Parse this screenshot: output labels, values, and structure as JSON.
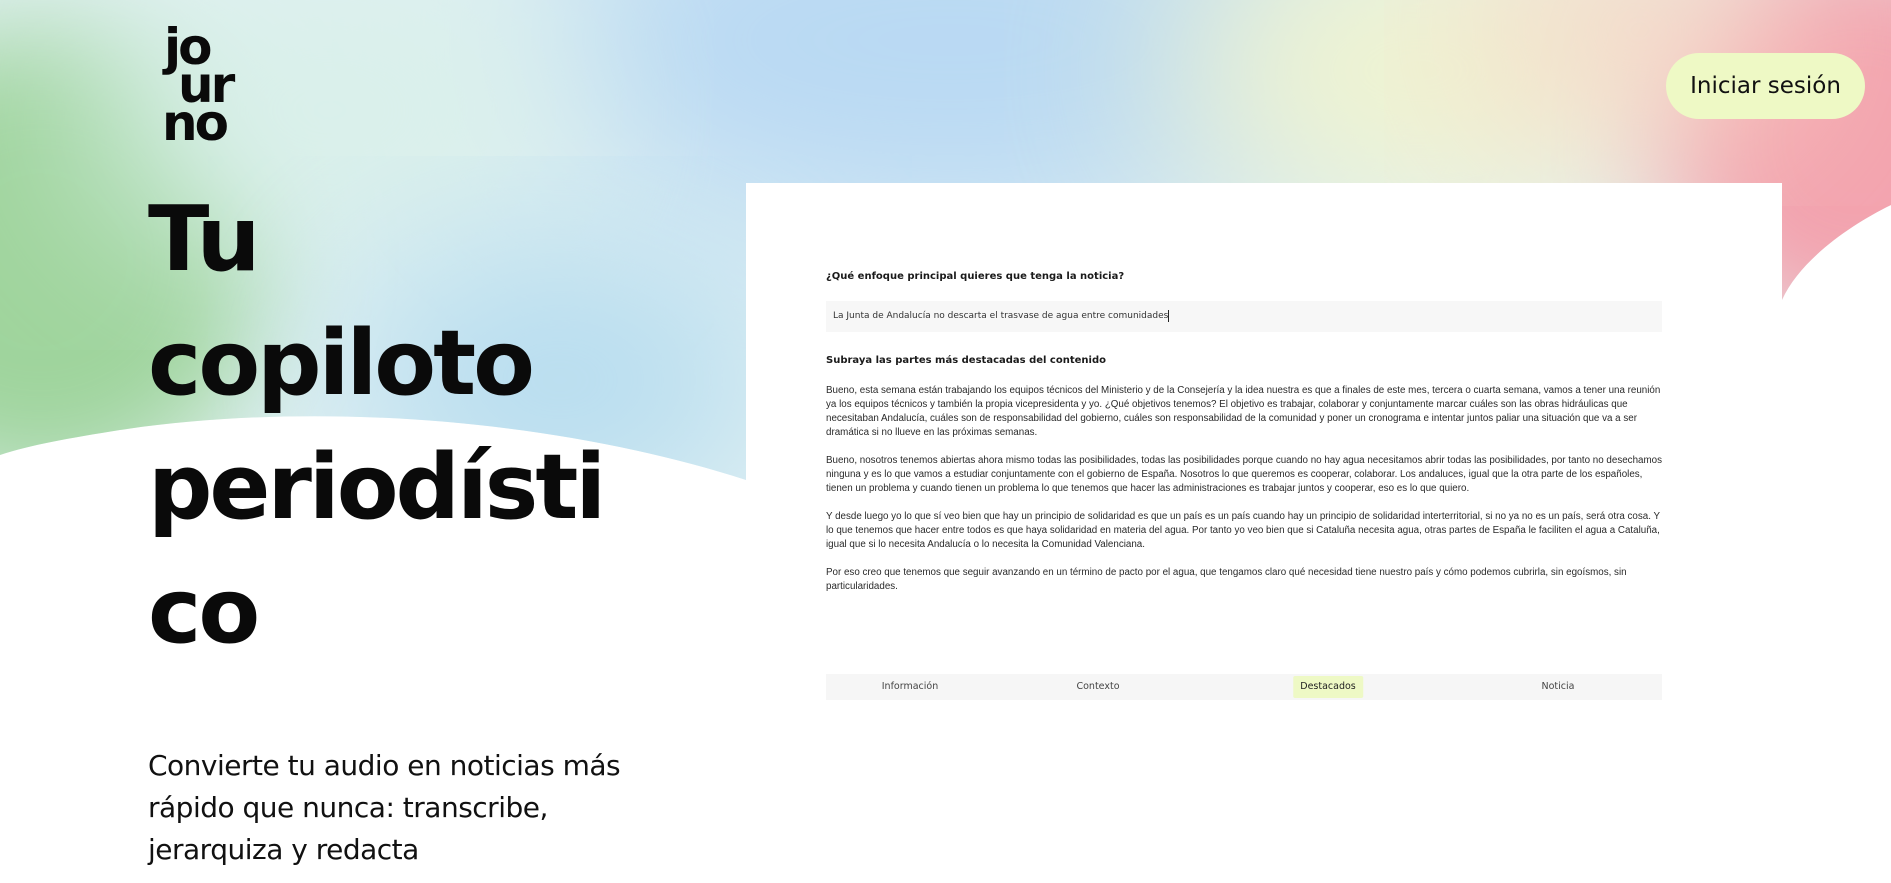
{
  "brand": {
    "logo_line_1": "jo",
    "logo_line_2": "ur",
    "logo_line_3": "no"
  },
  "header": {
    "login_label": "Iniciar sesión"
  },
  "hero": {
    "title_lines": [
      "Tu",
      "copiloto",
      "periodísti",
      "co"
    ],
    "subtitle": "Convierte tu audio en noticias más rápido que nunca: transcribe, jerarquiza y redacta"
  },
  "demo": {
    "question_label": "¿Qué enfoque principal quieres que tenga la noticia?",
    "question_value": "La Junta de Andalucía no descarta el trasvase de agua entre comunidades",
    "highlight_label": "Subraya las partes más destacadas del contenido",
    "paragraphs": [
      "Bueno, esta semana están trabajando los equipos técnicos del Ministerio y de la Consejería y la idea nuestra es que a finales de este mes, tercera o cuarta semana, vamos a tener una reunión ya los equipos técnicos y también la propia vicepresidenta y yo. ¿Qué objetivos tenemos? El objetivo es trabajar, colaborar y conjuntamente marcar cuáles son las obras hidráulicas que necesitaban Andalucía, cuáles son de responsabilidad del gobierno, cuáles son responsabilidad de la comunidad y poner un cronograma e intentar juntos paliar una situación que va a ser dramática si no llueve en las próximas semanas.",
      "Bueno, nosotros tenemos abiertas ahora mismo todas las posibilidades, todas las posibilidades porque cuando no hay agua necesitamos abrir todas las posibilidades, por tanto no desechamos ninguna y es lo que vamos a estudiar conjuntamente con el gobierno de España. Nosotros lo que queremos es cooperar, colaborar. Los andaluces, igual que la otra parte de los españoles, tienen un problema y cuando tienen un problema lo que tenemos que hacer las administraciones es trabajar juntos y cooperar, eso es lo que quiero.",
      "Y desde luego yo lo que sí veo bien que hay un principio de solidaridad es que un país es un país cuando hay un principio de solidaridad interterritorial, si no ya no es un país, será otra cosa. Y lo que tenemos que hacer entre todos es que haya solidaridad en materia del agua. Por tanto yo veo bien que si Cataluña necesita agua, otras partes de España le faciliten el agua a Cataluña, igual que si lo necesita Andalucía o lo necesita la Comunidad Valenciana.",
      "Por eso creo que tenemos que seguir avanzando en un término de pacto por el agua, que tengamos claro qué necesidad tiene nuestro país y cómo podemos cubrirla, sin egoísmos, sin particularidades."
    ],
    "steps": [
      "Información",
      "Contexto",
      "Destacados",
      "Noticia"
    ],
    "active_step": "Destacados"
  },
  "colors": {
    "accent": "#eef9c5",
    "text": "#0b0b0b"
  }
}
